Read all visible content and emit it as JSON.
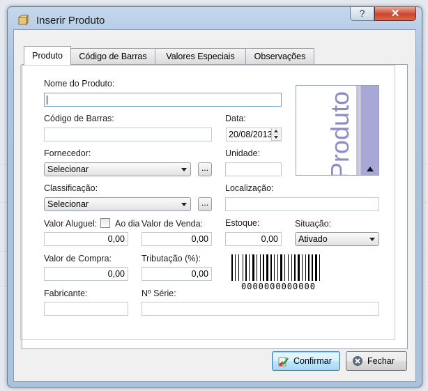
{
  "window": {
    "title": "Inserir Produto",
    "help_label": "?",
    "close_label": "✕"
  },
  "tabs": [
    {
      "label": "Produto",
      "active": true
    },
    {
      "label": "Código de Barras",
      "active": false
    },
    {
      "label": "Valores Especiais",
      "active": false
    },
    {
      "label": "Observações",
      "active": false
    }
  ],
  "form": {
    "nome_label": "Nome do Produto:",
    "nome_value": "",
    "codigo_label": "Código de Barras:",
    "codigo_value": "",
    "data_label": "Data:",
    "data_value": "20/08/2013",
    "fornecedor_label": "Fornecedor:",
    "fornecedor_value": "Selecionar",
    "unidade_label": "Unidade:",
    "unidade_value": "",
    "classificacao_label": "Classificação:",
    "classificacao_value": "Selecionar",
    "localizacao_label": "Localização:",
    "localizacao_value": "",
    "browse_label": "...",
    "aluguel_label": "Valor Aluguel:",
    "ao_dia_label": "Ao dia",
    "aluguel_value": "0,00",
    "venda_label": "Valor de Venda:",
    "venda_value": "0,00",
    "estoque_label": "Estoque:",
    "estoque_value": "0,00",
    "situacao_label": "Situação:",
    "situacao_value": "Ativado",
    "compra_label": "Valor de Compra:",
    "compra_value": "0,00",
    "tributacao_label": "Tributação (%):",
    "tributacao_value": "0,00",
    "fabricante_label": "Fabricante:",
    "fabricante_value": "",
    "serie_label": "Nº Série:",
    "serie_value": ""
  },
  "image_preview": {
    "text": "Produto"
  },
  "barcode": {
    "digits": "0000000000000"
  },
  "buttons": {
    "confirm": "Confirmar",
    "close": "Fechar"
  },
  "colors": {
    "accent": "#3c7fb1",
    "title_bar": "#b6cde6",
    "close_red": "#c9452d",
    "preview_purple": "#8c8cc6"
  },
  "icons": {
    "title": "product-box-icon",
    "confirm": "confirm-check-icon",
    "close": "close-circle-icon"
  }
}
